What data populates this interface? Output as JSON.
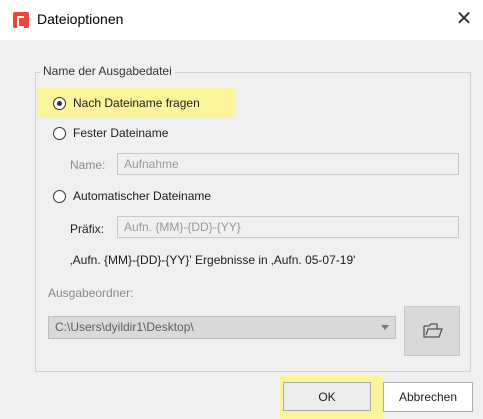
{
  "window": {
    "title": "Dateioptionen",
    "close_glyph": "✕",
    "app_icon": "app-logo-icon",
    "highlight_color": "#fbf49a"
  },
  "group": {
    "legend": "Name der Ausgabedatei"
  },
  "options": [
    {
      "label": "Nach Dateiname fragen",
      "checked": true
    },
    {
      "label": "Fester Dateiname",
      "checked": false
    },
    {
      "label": "Automatischer Dateiname",
      "checked": false
    }
  ],
  "fixed_name": {
    "label": "Name:",
    "value": "Aufnahme"
  },
  "auto_name": {
    "label": "Präfix:",
    "value": "Aufn. {MM}-{DD}-{YY}",
    "preview": "‚Aufn. {MM}-{DD}-{YY}' Ergebnisse in ‚Aufn. 05-07-19'"
  },
  "output_folder": {
    "label": "Ausgabeordner:",
    "value": "C:\\Users\\dyildir1\\Desktop\\",
    "browse_icon": "folder-open-icon"
  },
  "buttons": {
    "ok": "OK",
    "cancel": "Abbrechen"
  }
}
